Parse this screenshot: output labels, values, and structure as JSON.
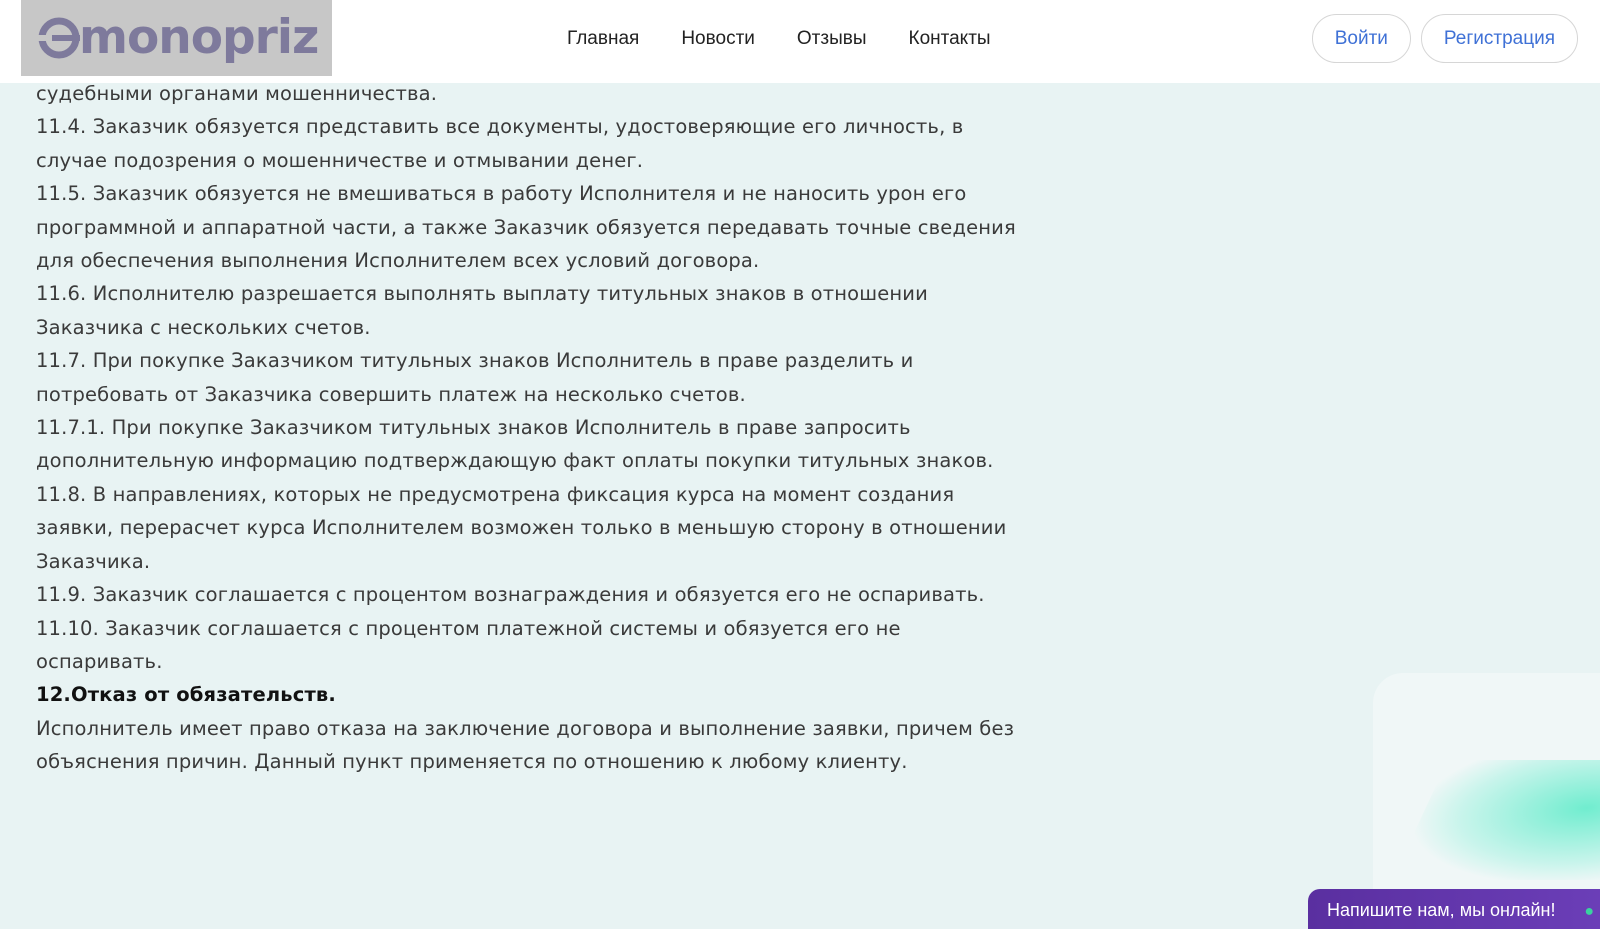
{
  "header": {
    "logo_text": "monopriz",
    "nav": [
      "Главная",
      "Новости",
      "Отзывы",
      "Контакты"
    ],
    "login_label": "Войти",
    "register_label": "Регистрация"
  },
  "content": {
    "paragraphs": [
      "судебными органами мошенничества.",
      "11.4. Заказчик обязуется представить все документы, удостоверяющие его личность, в случае подозрения о мошенничестве и отмывании денег.",
      "11.5. Заказчик обязуется не вмешиваться в работу Исполнителя и не наносить урон его программной и аппаратной части, а также Заказчик обязуется передавать точные сведения для обеспечения выполнения Исполнителем всех условий договора.",
      "11.6. Исполнителю разрешается выполнять выплату титульных знаков в отношении Заказчика с нескольких счетов.",
      "11.7. При покупке Заказчиком титульных знаков Исполнитель в праве разделить и потребовать от Заказчика совершить платеж на несколько счетов.",
      "11.7.1. При покупке Заказчиком титульных знаков Исполнитель в праве запросить дополнительную информацию подтверждающую факт оплаты покупки титульных знаков.",
      "11.8. В направлениях, которых не предусмотрена фиксация курса на момент создания заявки, перерасчет курса Исполнителем возможен только в меньшую сторону в отношении Заказчика.",
      "11.9. Заказчик соглашается с процентом вознаграждения и обязуется его не оспаривать.",
      "11.10. Заказчик соглашается с процентом платежной системы и обязуется его не оспаривать."
    ],
    "section_heading": "12.Отказ от обязательств.",
    "section_text": "Исполнитель имеет право отказа на заключение договора и выполнение заявки, причем без объяснения причин. Данный пункт применяется по отношению к любому клиенту."
  },
  "chat": {
    "label": "Напишите нам, мы онлайн!",
    "icon": "chat-icon"
  },
  "colors": {
    "background": "#e8f3f3",
    "accent": "#3f71d6",
    "chat": "#5a2fa0"
  }
}
